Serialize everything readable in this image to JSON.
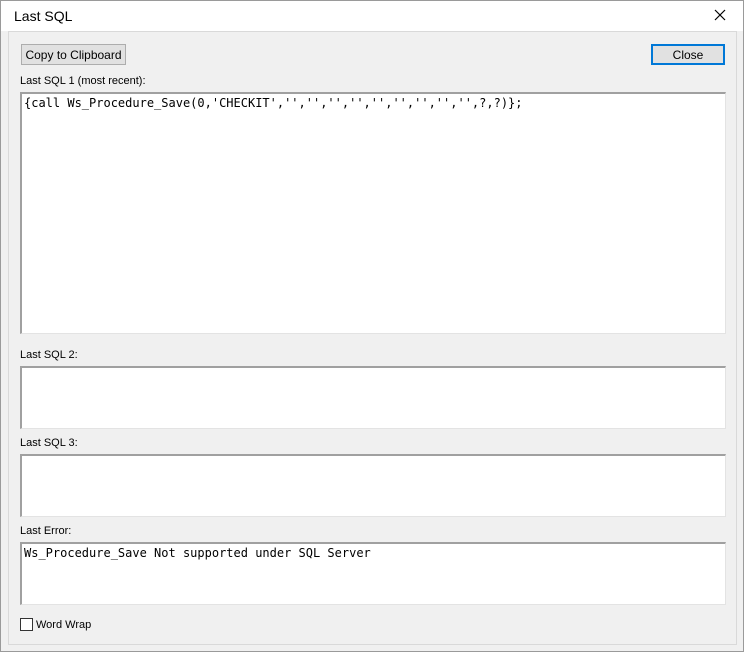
{
  "window": {
    "title": "Last SQL"
  },
  "toolbar": {
    "copy_label": "Copy to Clipboard",
    "close_label": "Close"
  },
  "sections": {
    "sql1": {
      "label": "Last SQL 1 (most recent):",
      "value": "{call Ws_Procedure_Save(0,'CHECKIT','','','','','','','','','',?,?)};"
    },
    "sql2": {
      "label": "Last SQL 2:",
      "value": ""
    },
    "sql3": {
      "label": "Last SQL 3:",
      "value": ""
    },
    "error": {
      "label": "Last Error:",
      "value": "Ws_Procedure_Save Not supported under SQL Server"
    }
  },
  "options": {
    "word_wrap_label": "Word Wrap",
    "word_wrap_checked": false
  },
  "icons": {
    "close": "close-icon"
  },
  "colors": {
    "accent": "#0078d7",
    "background": "#f0f0f0"
  }
}
